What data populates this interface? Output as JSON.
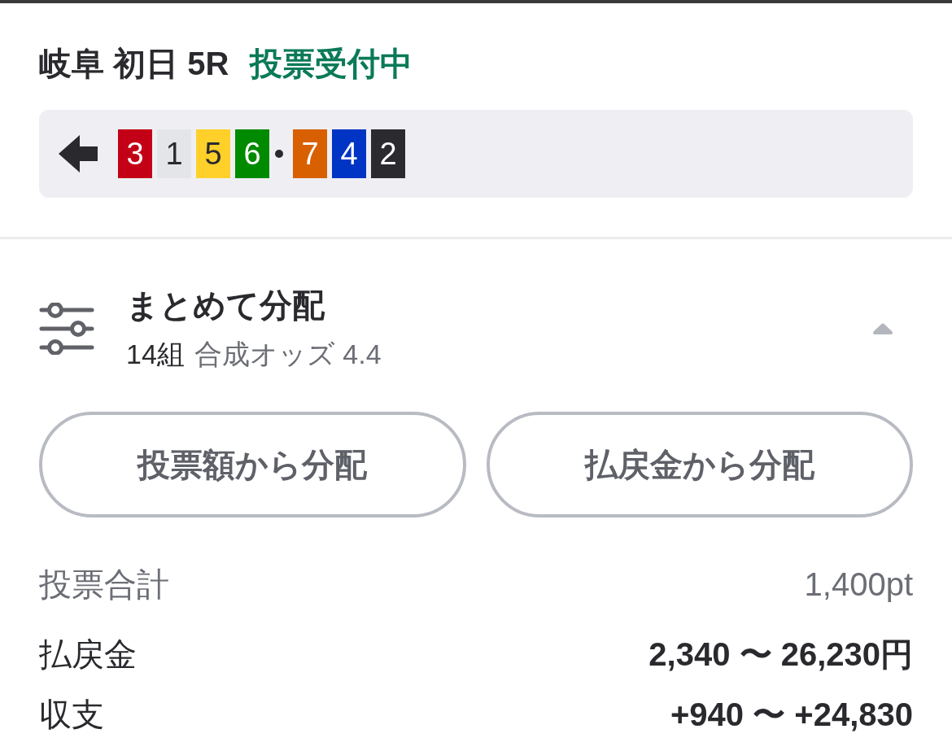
{
  "race": {
    "title": "岐阜 初日 5R",
    "status": "投票受付中"
  },
  "combination": {
    "groups": [
      [
        {
          "number": "3",
          "color": "#c30016"
        },
        {
          "number": "1",
          "color": "#e4e5e9"
        },
        {
          "number": "5",
          "color": "#ffd02a"
        },
        {
          "number": "6",
          "color": "#008a00"
        }
      ],
      [
        {
          "number": "7",
          "color": "#d86000"
        },
        {
          "number": "4",
          "color": "#0034c5"
        },
        {
          "number": "2",
          "color": "#2b2b2f"
        }
      ]
    ]
  },
  "distribution": {
    "title": "まとめて分配",
    "count": "14組",
    "odds": "合成オッズ 4.4",
    "expanded": true
  },
  "buttons": [
    "投票額から分配",
    "払戻金から分配"
  ],
  "summary": [
    {
      "kind": "total",
      "label": "投票合計",
      "value": "1,400pt"
    },
    {
      "kind": "payout",
      "label": "払戻金",
      "value": "2,340 〜 26,230円"
    },
    {
      "kind": "balance",
      "label": "収支",
      "value": "+940 〜 +24,830"
    }
  ]
}
